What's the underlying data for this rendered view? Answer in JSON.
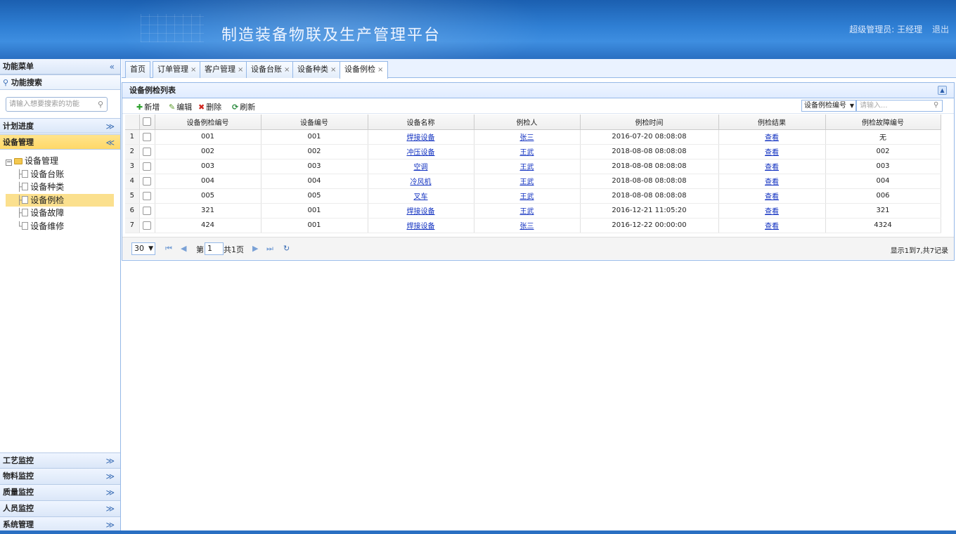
{
  "header": {
    "title": "制造装备物联及生产管理平台",
    "user_label": "超级管理员: 王经理",
    "logout": "退出"
  },
  "sidebar": {
    "title": "功能菜单",
    "search_title": "功能搜索",
    "search_placeholder": "请输入想要搜索的功能",
    "sections_top": [
      {
        "label": "计划进度"
      },
      {
        "label": "设备管理"
      }
    ],
    "tree_root": "设备管理",
    "tree_items": [
      {
        "label": "设备台账"
      },
      {
        "label": "设备种类"
      },
      {
        "label": "设备例检"
      },
      {
        "label": "设备故障"
      },
      {
        "label": "设备维修"
      }
    ],
    "sections_bottom": [
      {
        "label": "工艺监控"
      },
      {
        "label": "物料监控"
      },
      {
        "label": "质量监控"
      },
      {
        "label": "人员监控"
      },
      {
        "label": "系统管理"
      }
    ]
  },
  "tabs": [
    {
      "label": "首页"
    },
    {
      "label": "订单管理"
    },
    {
      "label": "客户管理"
    },
    {
      "label": "设备台账"
    },
    {
      "label": "设备种类"
    },
    {
      "label": "设备例检"
    }
  ],
  "panel": {
    "title": "设备例检列表",
    "toolbar": {
      "add": "新增",
      "edit": "编辑",
      "delete": "删除",
      "refresh": "刷新"
    },
    "search_field": "设备例检编号",
    "search_placeholder": "请输入..."
  },
  "table": {
    "columns": [
      "设备例检编号",
      "设备编号",
      "设备名称",
      "例检人",
      "例检时间",
      "例检结果",
      "例检故障编号"
    ],
    "rows": [
      {
        "n": "1",
        "id": "001",
        "dev": "001",
        "name": "焊接设备",
        "person": "张三",
        "time": "2016-07-20 08:08:08",
        "result": "查看",
        "fault": "无"
      },
      {
        "n": "2",
        "id": "002",
        "dev": "002",
        "name": "冲压设备",
        "person": "王武",
        "time": "2018-08-08 08:08:08",
        "result": "查看",
        "fault": "002"
      },
      {
        "n": "3",
        "id": "003",
        "dev": "003",
        "name": "空调",
        "person": "王武",
        "time": "2018-08-08 08:08:08",
        "result": "查看",
        "fault": "003"
      },
      {
        "n": "4",
        "id": "004",
        "dev": "004",
        "name": "冷风机",
        "person": "王武",
        "time": "2018-08-08 08:08:08",
        "result": "查看",
        "fault": "004"
      },
      {
        "n": "5",
        "id": "005",
        "dev": "005",
        "name": "叉车",
        "person": "王武",
        "time": "2018-08-08 08:08:08",
        "result": "查看",
        "fault": "006"
      },
      {
        "n": "6",
        "id": "321",
        "dev": "001",
        "name": "焊接设备",
        "person": "王武",
        "time": "2016-12-21 11:05:20",
        "result": "查看",
        "fault": "321"
      },
      {
        "n": "7",
        "id": "424",
        "dev": "001",
        "name": "焊接设备",
        "person": "张三",
        "time": "2016-12-22 00:00:00",
        "result": "查看",
        "fault": "4324"
      }
    ]
  },
  "pager": {
    "page_size": "30",
    "page_prefix": "第",
    "page_value": "1",
    "page_suffix": "共1页",
    "info": "显示1到7,共7记录"
  }
}
